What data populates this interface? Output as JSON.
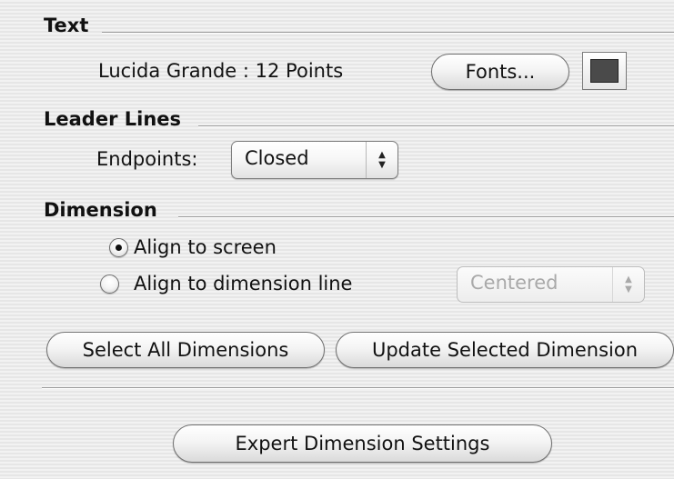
{
  "text_section": {
    "title": "Text",
    "font_label": "Lucida Grande : 12 Points",
    "fonts_button": "Fonts...",
    "color": "#4a4a4a"
  },
  "leader_section": {
    "title": "Leader Lines",
    "endpoints_label": "Endpoints:",
    "endpoints_value": "Closed"
  },
  "dimension_section": {
    "title": "Dimension",
    "align_screen": "Align to screen",
    "align_line": "Align to dimension line",
    "align_selected": "screen",
    "position_value": "Centered"
  },
  "buttons": {
    "select_all": "Select All Dimensions",
    "update_selected": "Update Selected Dimension",
    "expert": "Expert Dimension Settings"
  }
}
